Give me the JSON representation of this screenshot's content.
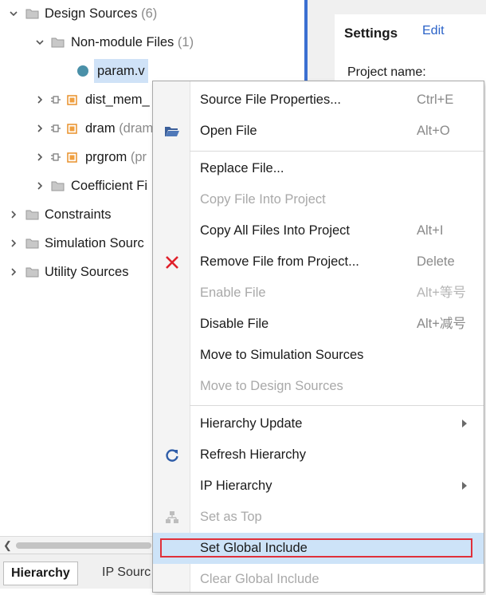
{
  "tree": {
    "design_sources": {
      "label": "Design Sources",
      "count": "(6)"
    },
    "non_module": {
      "label": "Non-module Files",
      "count": "(1)"
    },
    "param": {
      "label": "param.v"
    },
    "dist_mem": {
      "label": "dist_mem_"
    },
    "dram": {
      "label": "dram",
      "extra": "(dram"
    },
    "prgrom": {
      "label": "prgrom",
      "extra": "(pr"
    },
    "coefficient": {
      "label": "Coefficient Fi"
    },
    "constraints": {
      "label": "Constraints"
    },
    "simulation": {
      "label": "Simulation Sourc"
    },
    "utility": {
      "label": "Utility Sources"
    }
  },
  "settings": {
    "title": "Settings",
    "edit": "Edit",
    "project_name": "Project name:"
  },
  "tabs": {
    "hierarchy": "Hierarchy",
    "ip_sources": "IP Sourc"
  },
  "menu": {
    "items": [
      {
        "label": "Source File Properties...",
        "shortcut": "Ctrl+E",
        "icon": "none"
      },
      {
        "label": "Open File",
        "shortcut": "Alt+O",
        "icon": "open-folder-icon"
      },
      {
        "label": "Replace File...",
        "shortcut": "",
        "icon": "none"
      },
      {
        "label": "Copy File Into Project",
        "shortcut": "",
        "icon": "none",
        "disabled": true
      },
      {
        "label": "Copy All Files Into Project",
        "shortcut": "Alt+I",
        "icon": "none"
      },
      {
        "label": "Remove File from Project...",
        "shortcut": "Delete",
        "icon": "remove-x-icon"
      },
      {
        "label": "Enable File",
        "shortcut": "Alt+等号",
        "icon": "none",
        "disabled": true
      },
      {
        "label": "Disable File",
        "shortcut": "Alt+减号",
        "icon": "none"
      },
      {
        "label": "Move to Simulation Sources",
        "shortcut": "",
        "icon": "none"
      },
      {
        "label": "Move to Design Sources",
        "shortcut": "",
        "icon": "none",
        "disabled": true
      },
      {
        "label": "Hierarchy Update",
        "shortcut": "",
        "icon": "none",
        "submenu": true
      },
      {
        "label": "Refresh Hierarchy",
        "shortcut": "",
        "icon": "refresh-icon"
      },
      {
        "label": "IP Hierarchy",
        "shortcut": "",
        "icon": "none",
        "submenu": true
      },
      {
        "label": "Set as Top",
        "shortcut": "",
        "icon": "set-top-icon",
        "disabled": true
      },
      {
        "label": "Set Global Include",
        "shortcut": "",
        "icon": "none",
        "highlighted": true
      },
      {
        "label": "Clear Global Include",
        "shortcut": "",
        "icon": "none",
        "disabled": true
      }
    ]
  },
  "colors": {
    "accent": "#2a62c8",
    "selection": "#cfe2f7",
    "highlight_box": "#e0303a",
    "remove_x": "#e0202a"
  }
}
